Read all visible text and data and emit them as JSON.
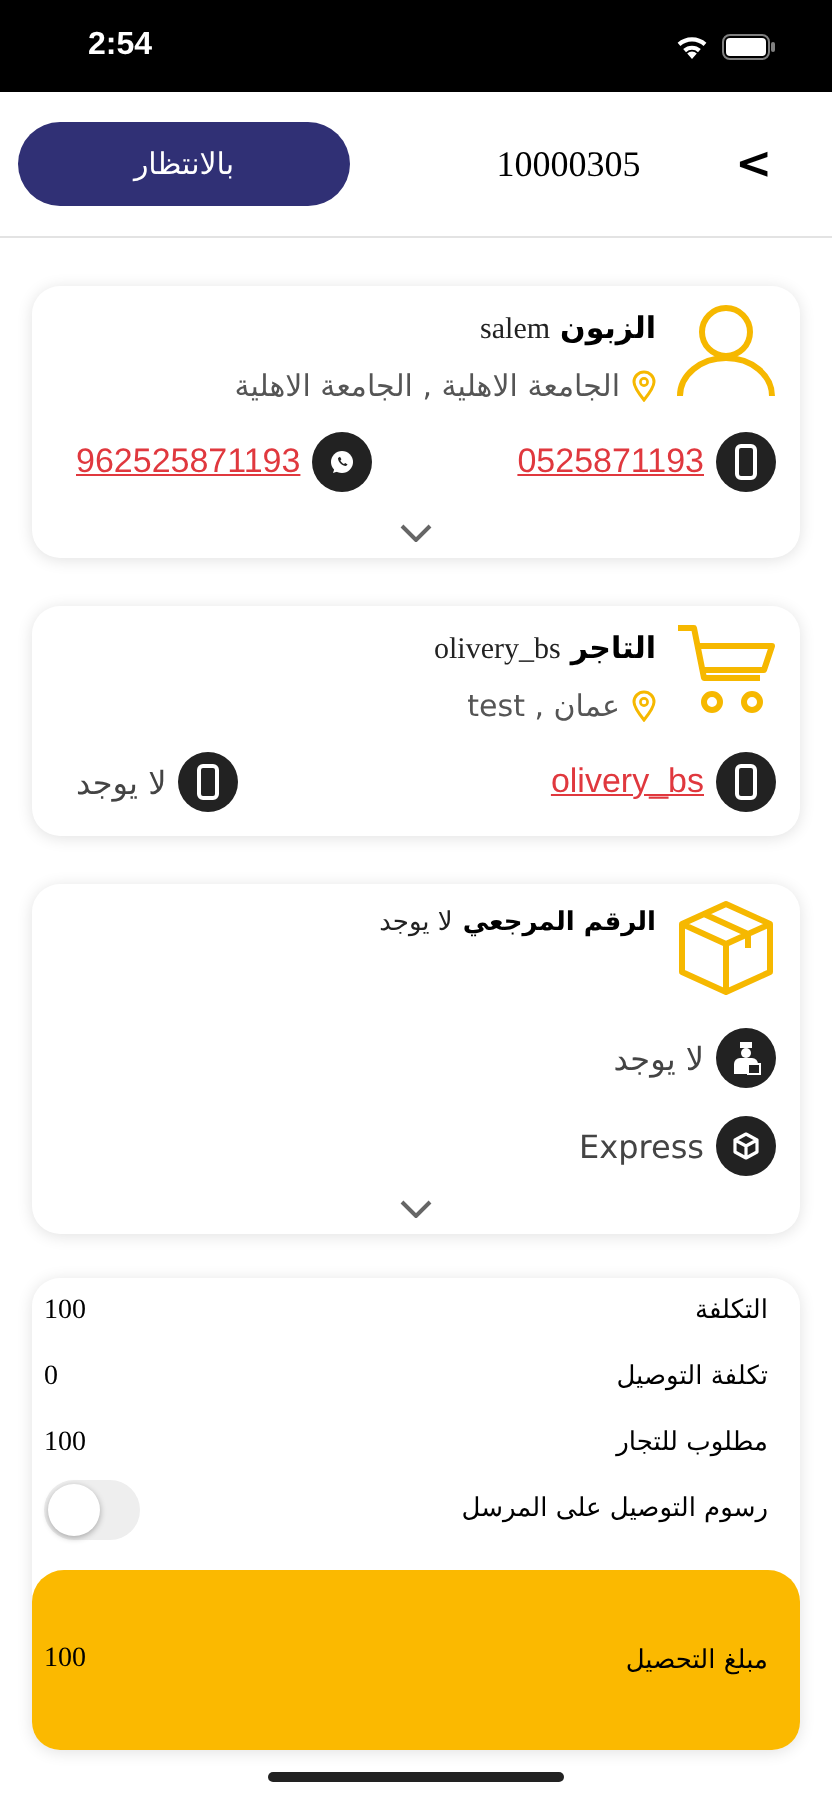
{
  "status_bar": {
    "time": "2:54"
  },
  "header": {
    "back": ">",
    "order_number": "10000305",
    "status": "بالانتظار"
  },
  "customer": {
    "label": "الزبون",
    "name": "salem",
    "address": "الجامعة الاهلية , الجامعة الاهلية",
    "expandable": true,
    "contacts": [
      {
        "kind": "phone",
        "text": "0525871193",
        "link": true
      },
      {
        "kind": "whatsapp",
        "text": "962525871193",
        "link": true
      }
    ]
  },
  "merchant": {
    "label": "التاجر",
    "name": "olivery_bs",
    "address": "عمان , test",
    "expandable": false,
    "contacts": [
      {
        "kind": "phone",
        "text": "olivery_bs",
        "link": true
      },
      {
        "kind": "phone",
        "text": "لا يوجد",
        "link": false
      }
    ]
  },
  "package": {
    "reference_label": "الرقم المرجعي",
    "reference_value": "لا يوجد",
    "expandable": true,
    "details": [
      {
        "kind": "driver",
        "text": "لا يوجد"
      },
      {
        "kind": "service",
        "text": "Express"
      }
    ]
  },
  "summary": [
    {
      "kind": "value",
      "label": "التكلفة",
      "value": "100"
    },
    {
      "kind": "value",
      "label": "تكلفة التوصيل",
      "value": "0"
    },
    {
      "kind": "value",
      "label": "مطلوب للتجار",
      "value": "100"
    },
    {
      "kind": "toggle",
      "label": "رسوم التوصيل على المرسل",
      "on": false
    },
    {
      "kind": "total",
      "label": "مبلغ التحصيل",
      "value": "100"
    }
  ]
}
